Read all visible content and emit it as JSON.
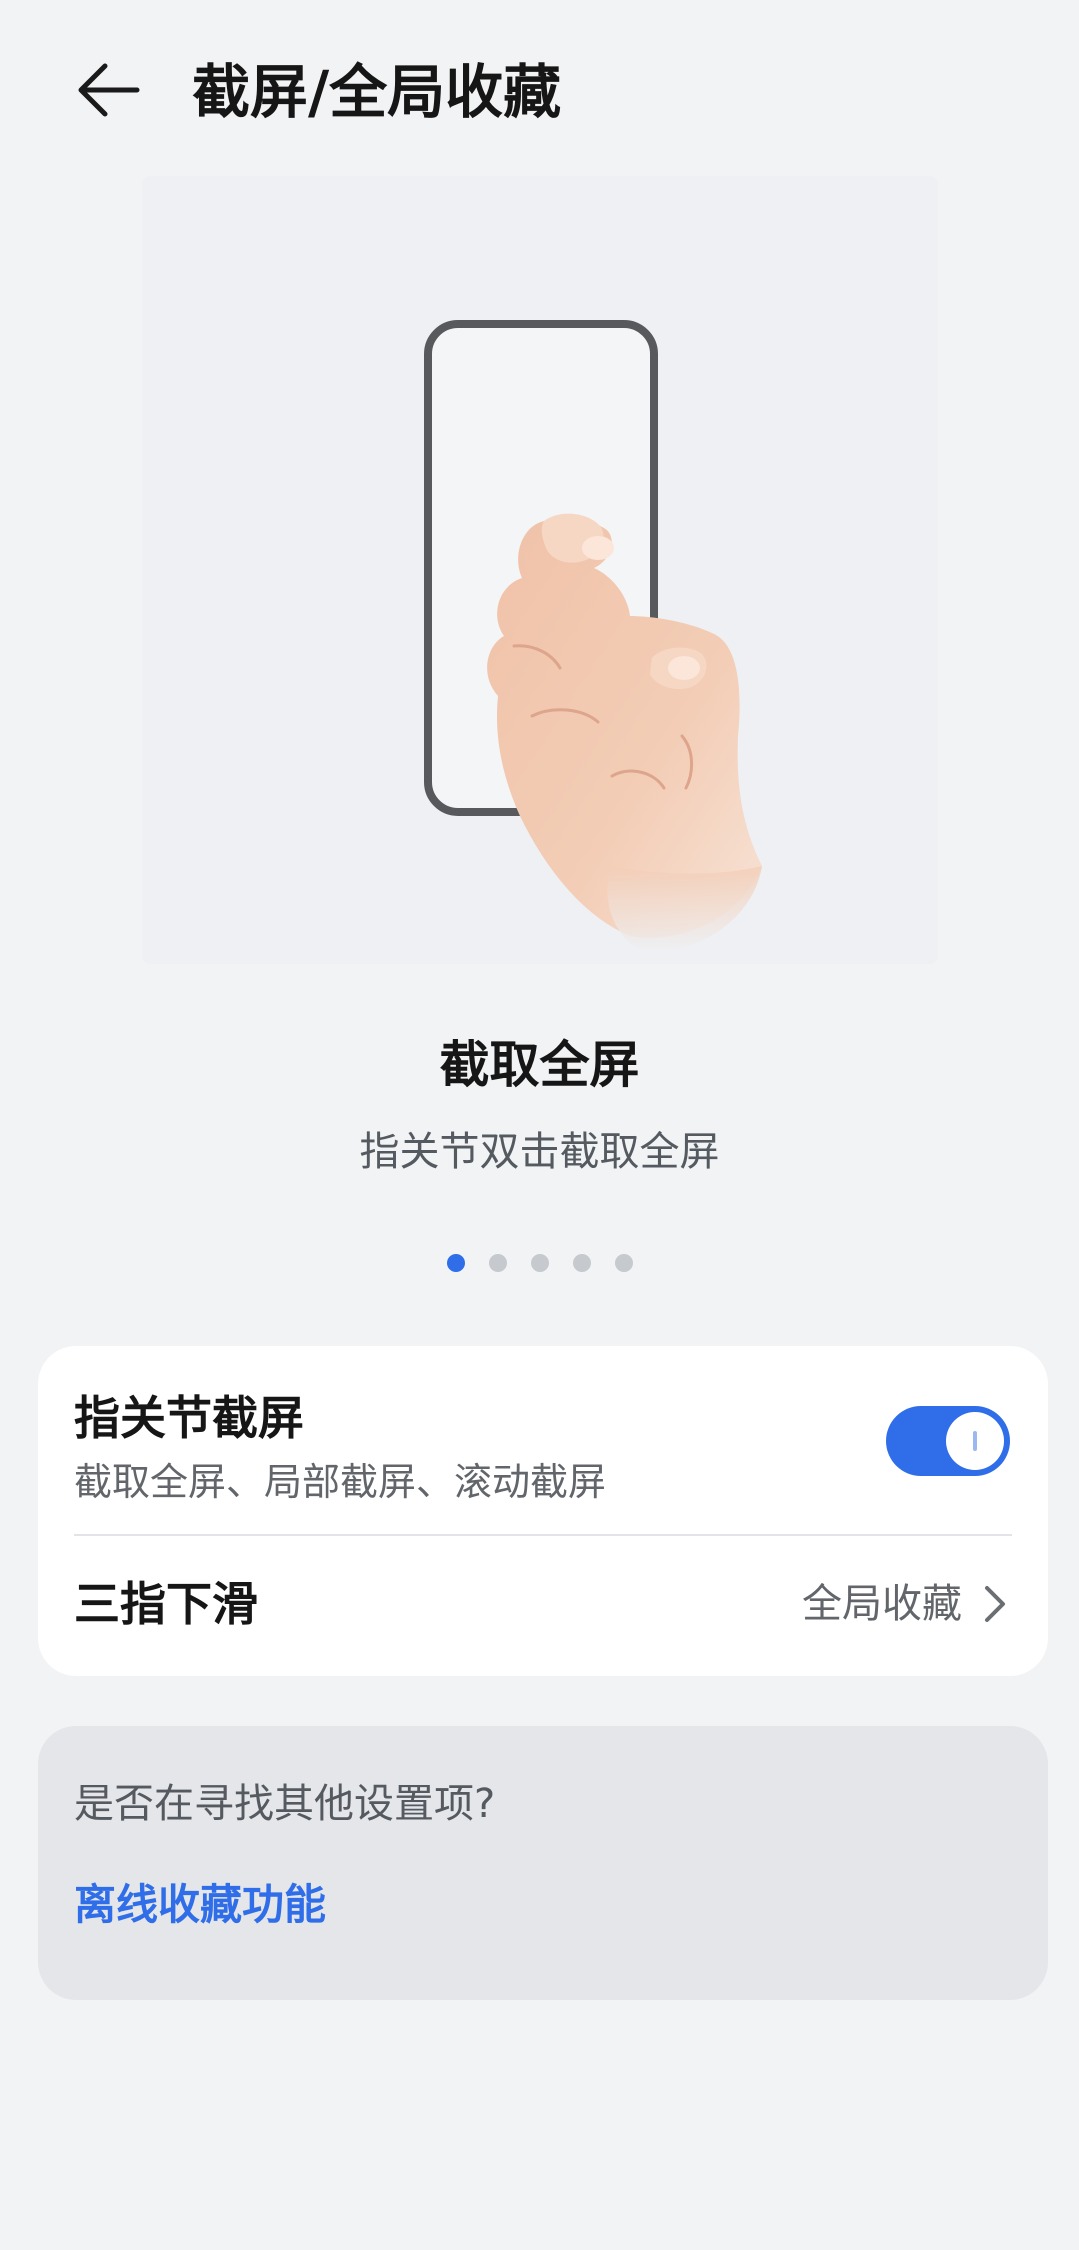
{
  "header": {
    "back_icon": "arrow-left-icon",
    "title": "截屏/全局收藏"
  },
  "illustration": {
    "icon": "phone-knuckle-double-tap-illustration"
  },
  "feature": {
    "title": "截取全屏",
    "description": "指关节双击截取全屏"
  },
  "pager": {
    "count": 5,
    "active_index": 0
  },
  "settings": {
    "knuckle": {
      "title": "指关节截屏",
      "subtitle": "截取全屏、局部截屏、滚动截屏",
      "enabled": true
    },
    "three_finger": {
      "title": "三指下滑",
      "value": "全局收藏",
      "chevron_icon": "chevron-right-icon"
    }
  },
  "suggestions": {
    "label": "是否在寻找其他设置项?",
    "link": "离线收藏功能"
  },
  "colors": {
    "accent": "#2f6ee8",
    "background": "#f1f3f5",
    "card": "#ffffff",
    "suggest_card": "#e4e6e9"
  }
}
